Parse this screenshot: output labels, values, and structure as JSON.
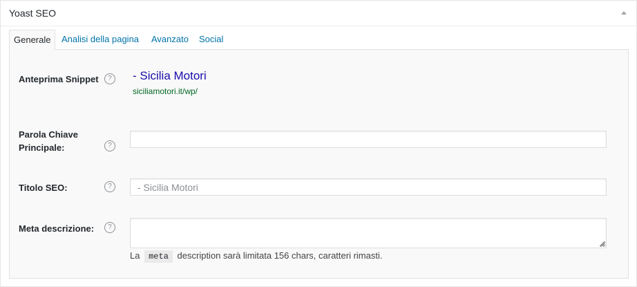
{
  "metabox": {
    "title": "Yoast SEO"
  },
  "tabs": [
    {
      "label": "Generale",
      "active": true
    },
    {
      "label": "Analisi della pagina",
      "active": false
    },
    {
      "label": "Avanzato",
      "active": false
    },
    {
      "label": "Social",
      "active": false
    }
  ],
  "snippet": {
    "label": "Anteprima Snippet",
    "title": "- Sicilia Motori",
    "url": "siciliamotori.it/wp/"
  },
  "focus_keyword": {
    "label_line1": "Parola Chiave",
    "label_line2": "Principale:",
    "value": ""
  },
  "seo_title": {
    "label": "Titolo SEO:",
    "placeholder": "- Sicilia Motori",
    "value": ""
  },
  "meta_description": {
    "label": "Meta descrizione:",
    "value": "",
    "note_prefix": "La",
    "note_code": "meta",
    "note_suffix": "description sarà limitata 156 chars, caratteri rimasti."
  },
  "help_glyph": "?",
  "icons": {
    "toggle": "triangle-up-icon",
    "help": "question-circle-icon"
  },
  "colors": {
    "link": "#0073aa",
    "snippet_title": "#1a0dab",
    "snippet_url": "#006621"
  }
}
